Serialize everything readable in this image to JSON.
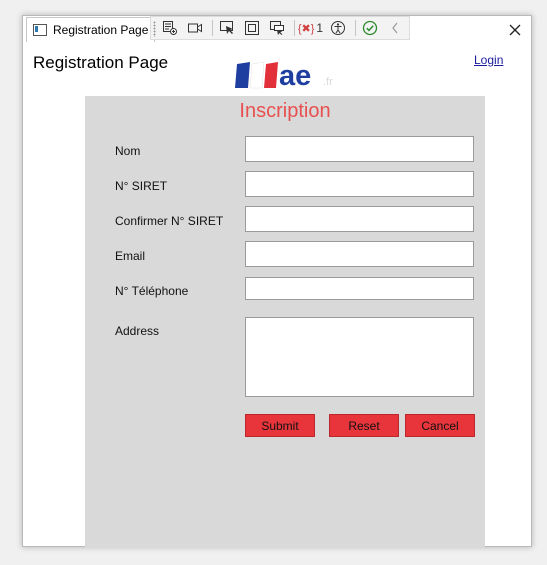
{
  "window": {
    "tab_title": "Registration Page",
    "error_count": "1"
  },
  "devtools": {
    "icons": [
      "live-visual-tree-icon",
      "camera-icon",
      "select-element-icon",
      "display-layout-adorners-icon",
      "track-focus-icon",
      "binding-errors-icon",
      "accessibility-checker-icon",
      "check-icon",
      "collapse-icon"
    ]
  },
  "header": {
    "page_title": "Registration Page",
    "login_label": "Login",
    "logo_text": "ae",
    "logo_suffix": ".fr"
  },
  "form": {
    "heading": "Inscription",
    "fields": [
      {
        "label": "Nom",
        "value": ""
      },
      {
        "label": "N° SIRET",
        "value": ""
      },
      {
        "label": "Confirmer N° SIRET",
        "value": ""
      },
      {
        "label": "Email",
        "value": ""
      },
      {
        "label": "N° Téléphone",
        "value": ""
      },
      {
        "label": "Address",
        "value": ""
      }
    ],
    "buttons": {
      "submit": "Submit",
      "reset": "Reset",
      "cancel": "Cancel"
    }
  },
  "colors": {
    "heading": "#e8504f",
    "button": "#e8353b",
    "panel": "#d9d9d9",
    "link": "#1a1a9c"
  }
}
